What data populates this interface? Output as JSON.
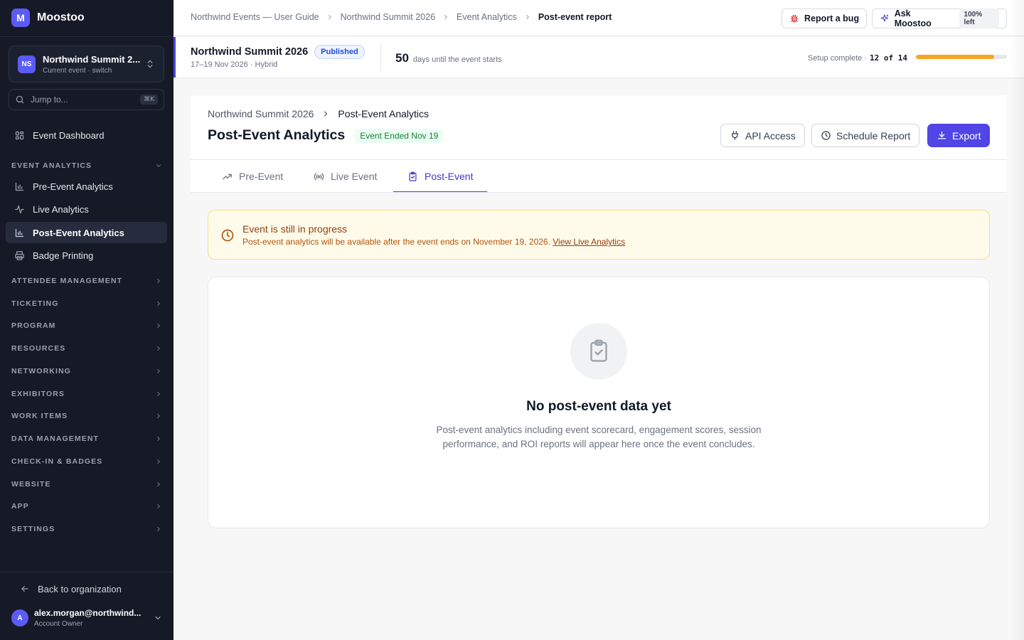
{
  "app": {
    "logo_letter": "M",
    "name": "Moostoo"
  },
  "event_switcher": {
    "initials": "NS",
    "name": "Northwind Summit 2...",
    "subtitle": "Current event · switch"
  },
  "jump": {
    "placeholder": "Jump to...",
    "shortcut": "⌘K"
  },
  "sidebar": {
    "dashboard": "Event Dashboard",
    "event_analytics_section": "EVENT ANALYTICS",
    "analytics_items": [
      "Pre-Event Analytics",
      "Live Analytics",
      "Post-Event Analytics",
      "Badge Printing"
    ],
    "sections": [
      "ATTENDEE MANAGEMENT",
      "TICKETING",
      "PROGRAM",
      "RESOURCES",
      "NETWORKING",
      "EXHIBITORS",
      "WORK ITEMS",
      "DATA MANAGEMENT",
      "CHECK-IN & BADGES",
      "WEBSITE",
      "APP",
      "SETTINGS"
    ],
    "back_to_org": "Back to organization",
    "user": {
      "initial": "A",
      "email": "alex.morgan@northwind...",
      "role": "Account Owner"
    }
  },
  "topbar": {
    "breadcrumbs": [
      "Northwind Events — User Guide",
      "Northwind Summit 2026",
      "Event Analytics",
      "Post-event report"
    ],
    "report_bug": "Report a bug",
    "ask": "Ask Moostoo",
    "ask_quota": "100% left"
  },
  "event_strip": {
    "name": "Northwind Summit 2026",
    "status": "Published",
    "date": "17–19 Nov 2026 · Hybrid",
    "days": "50",
    "days_text": "days until the event starts",
    "setup_label": "Setup complete ·",
    "setup_count": "12 of 14",
    "setup_progress": 0.857
  },
  "page": {
    "breadcrumbs": [
      "Northwind Summit 2026",
      "Post-Event Analytics"
    ],
    "title": "Post-Event Analytics",
    "badge": "Event Ended Nov 19",
    "api_access": "API Access",
    "schedule_report": "Schedule Report",
    "export": "Export",
    "tabs": [
      "Pre-Event",
      "Live Event",
      "Post-Event"
    ]
  },
  "alert": {
    "title": "Event is still in progress",
    "body": "Post-event analytics will be available after the event ends on November 19, 2026.",
    "link": "View Live Analytics"
  },
  "empty_state": {
    "title": "No post-event data yet",
    "body": "Post-event analytics including event scorecard, engagement scores, session performance, and ROI reports will appear here once the event concludes."
  },
  "colors": {
    "accent": "#4f46e5",
    "sidebar_bg": "#161a26",
    "warning": "#b45309",
    "progress": "#f5a623",
    "success": "#15803d"
  }
}
